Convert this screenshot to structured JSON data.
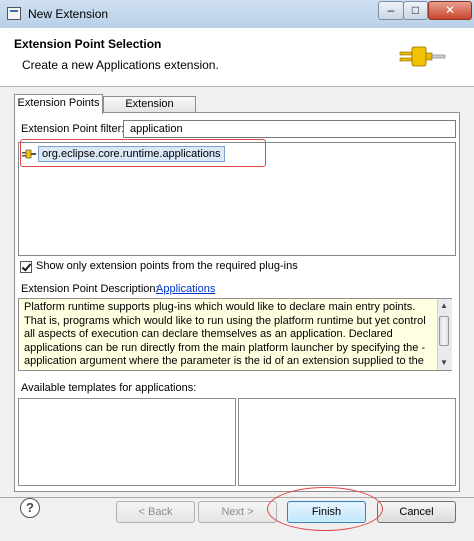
{
  "window": {
    "title": "New Extension",
    "minimize_glyph": "–",
    "maximize_glyph": "□",
    "close_glyph": "✕"
  },
  "header": {
    "title": "Extension Point Selection",
    "description": "Create a new Applications extension."
  },
  "tabs": [
    {
      "label": "Extension Points"
    },
    {
      "label": "Extension Wizards"
    }
  ],
  "filter": {
    "label": "Extension Point filter:",
    "value": "application"
  },
  "extension_points": [
    {
      "label": "org.eclipse.core.runtime.applications",
      "icon": "plug-icon"
    }
  ],
  "checkbox": {
    "label": "Show only extension points from the required plug-ins",
    "checked": true
  },
  "description": {
    "label": "Extension Point Description:",
    "link": "Applications",
    "text": "Platform runtime supports plug-ins which would like to declare main entry points.\nThat is, programs which would like to run using the platform runtime but yet control\nall aspects of execution can declare themselves as an application. Declared\napplications can be run directly from the main platform launcher by specifying the -\napplication argument where the parameter is the id of an extension supplied to the\napplications extension point described here. This application is in charge of running"
  },
  "templates": {
    "label": "Available templates for applications:"
  },
  "buttons": {
    "help": "?",
    "back": "< Back",
    "next": "Next >",
    "finish": "Finish",
    "cancel": "Cancel"
  },
  "colors": {
    "highlight_red": "#e04646",
    "link_blue": "#0033cc",
    "description_bg": "#ffffe1"
  }
}
